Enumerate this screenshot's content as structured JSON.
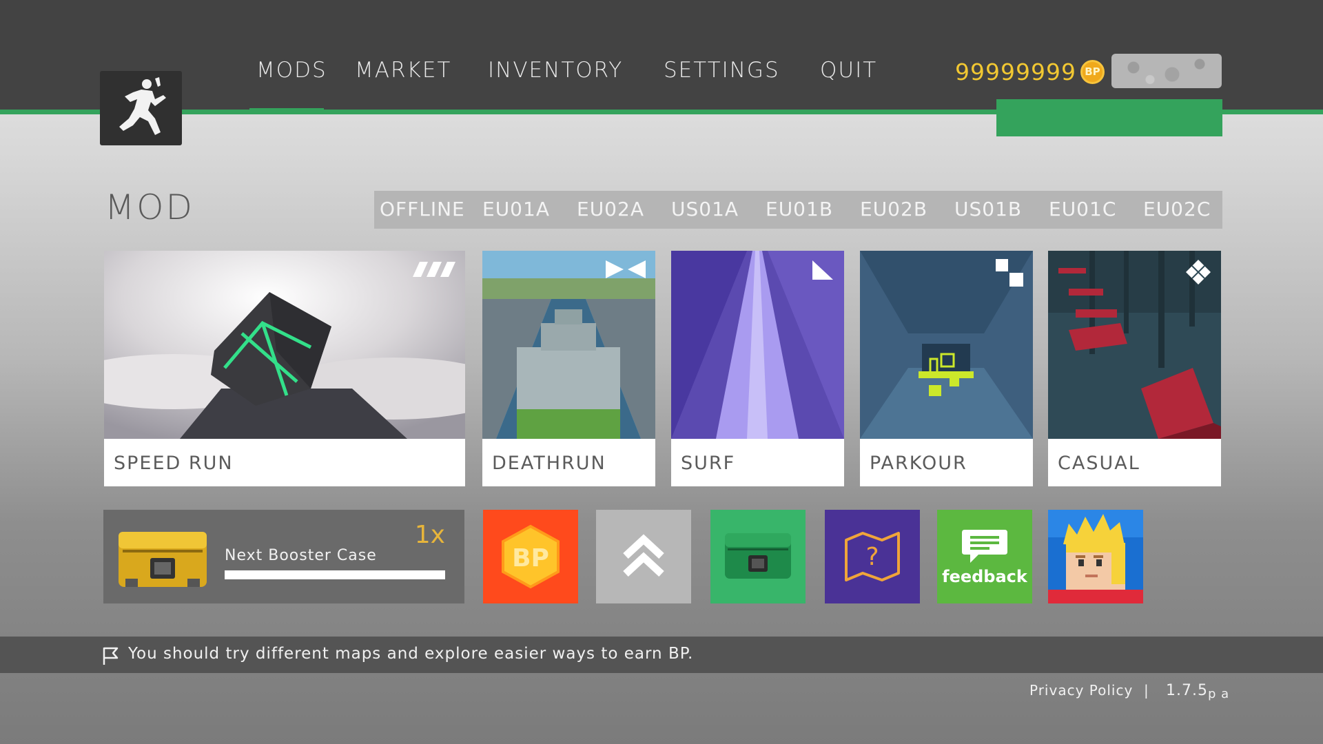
{
  "nav": {
    "items": [
      "MODS",
      "MARKET",
      "INVENTORY",
      "SETTINGS",
      "QUIT"
    ],
    "active": "MODS"
  },
  "currency": {
    "amount": "99999999",
    "symbol": "BP"
  },
  "mod_section": {
    "title": "MOD",
    "servers": [
      "OFFLINE",
      "EU01A",
      "EU02A",
      "US01A",
      "EU01B",
      "EU02B",
      "US01B",
      "EU01C",
      "EU02C"
    ]
  },
  "modes": [
    {
      "label": "SPEED RUN",
      "icon": "speed-stripes-icon"
    },
    {
      "label": "DEATHRUN",
      "icon": "bowtie-icon"
    },
    {
      "label": "SURF",
      "icon": "triangle-icon"
    },
    {
      "label": "PARKOUR",
      "icon": "squares-icon"
    },
    {
      "label": "CASUAL",
      "icon": "diamond-icon"
    }
  ],
  "booster": {
    "label": "Next Booster Case",
    "count": "1x",
    "progress": 1.0
  },
  "tiles": {
    "bp_text": "BP",
    "feedback_text": "feedback",
    "colors": [
      "#ff4a1c",
      "#b7b7b7",
      "#38b56a",
      "#4a3296",
      "#5cb840",
      "#1a6fd1"
    ]
  },
  "tip": {
    "text": "You should try different maps and explore easier ways to earn BP."
  },
  "footer": {
    "privacy": "Privacy Policy",
    "separator": "|",
    "version": "1.7.5",
    "version_suffix": "p a"
  },
  "colors": {
    "accent_green": "#34a35c",
    "currency_gold": "#f2c832",
    "topbar": "#434343"
  }
}
